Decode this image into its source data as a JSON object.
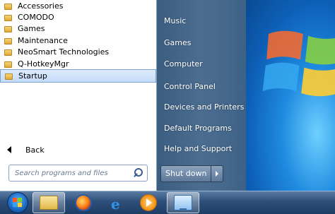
{
  "start_menu": {
    "folders": [
      {
        "label": "Accessories"
      },
      {
        "label": "COMODO"
      },
      {
        "label": "Games"
      },
      {
        "label": "Maintenance"
      },
      {
        "label": "NeoSmart Technologies"
      },
      {
        "label": "Q-HotkeyMgr"
      },
      {
        "label": "Startup",
        "selected": true
      }
    ],
    "back_label": "Back",
    "search_placeholder": "Search programs and files",
    "right_items": [
      "Music",
      "Games",
      "Computer",
      "Control Panel",
      "Devices and Printers",
      "Default Programs",
      "Help and Support"
    ],
    "shutdown_label": "Shut down"
  },
  "taskbar": {
    "items": [
      "start-orb-icon",
      "windows-explorer-icon",
      "firefox-icon",
      "internet-explorer-icon",
      "media-player-icon",
      "remote-desktop-icon"
    ]
  },
  "colors": {
    "selection_bg": "#c3dcf8",
    "right_panel": "#4b6d90",
    "taskbar": "#2d4e78"
  }
}
